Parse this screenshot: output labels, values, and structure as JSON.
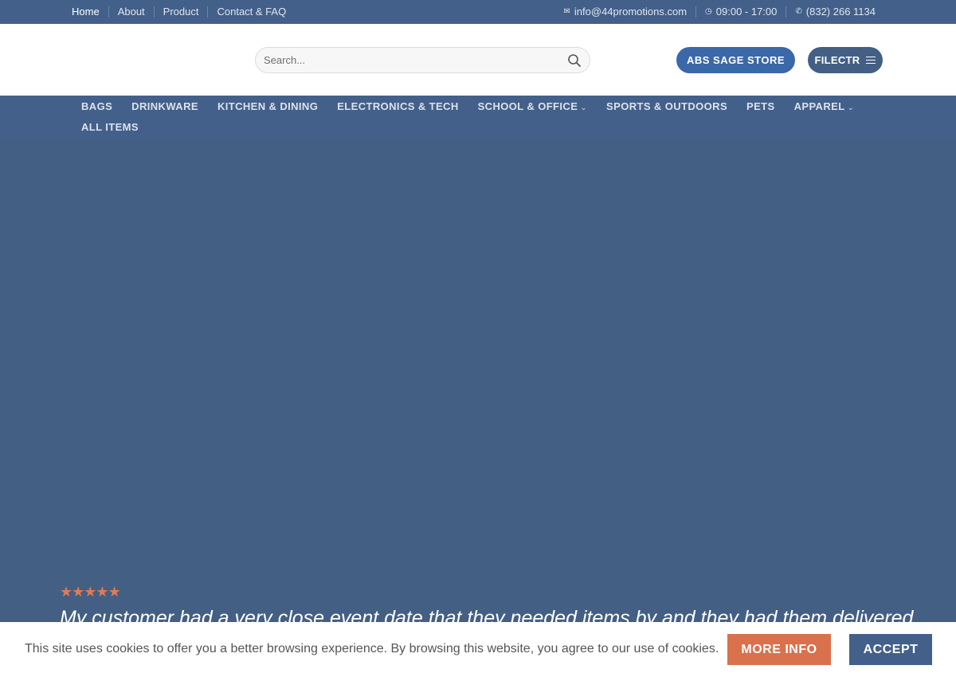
{
  "topbar": {
    "links": [
      "Home",
      "About",
      "Product",
      "Contact & FAQ"
    ],
    "email": "info@44promotions.com",
    "hours": "09:00 - 17:00",
    "phone": "(832) 266 1134"
  },
  "header": {
    "search_placeholder": "Search...",
    "abs_button": "ABS SAGE STORE",
    "filectr_button": "FILECTR"
  },
  "nav": {
    "items": [
      "BAGS",
      "DRINKWARE",
      "KITCHEN & DINING",
      "ELECTRONICS & TECH",
      "SCHOOL & OFFICE",
      "SPORTS & OUTDOORS",
      "PETS",
      "APPAREL",
      "ALL ITEMS"
    ]
  },
  "hero": {
    "rating": 5,
    "quote": "My customer had a very close event date that they needed items by and they had them delivered"
  },
  "cookie": {
    "message": "This site uses cookies to offer you a better browsing experience. By browsing this website, you agree to our use of cookies.",
    "more_info": "MORE INFO",
    "accept": "ACCEPT"
  },
  "colors": {
    "primary": "#43608a",
    "accent_blue": "#3b68a8",
    "accent_orange": "#d9714d",
    "star": "#e07a56"
  },
  "icons": {
    "email": "envelope-icon",
    "hours": "clock-icon",
    "phone": "phone-icon",
    "search": "search-icon",
    "menu": "hamburger-icon",
    "chevron": "chevron-down-icon",
    "star": "star-icon"
  }
}
